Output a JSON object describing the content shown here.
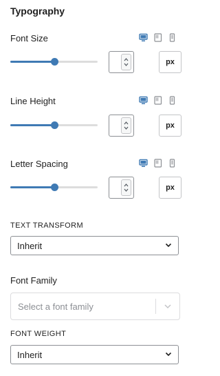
{
  "section_title": "Typography",
  "font_size": {
    "label": "Font Size",
    "value_fraction": 0.5,
    "value": "",
    "unit": "px"
  },
  "line_height": {
    "label": "Line Height",
    "value_fraction": 0.5,
    "value": "",
    "unit": "px"
  },
  "letter_spacing": {
    "label": "Letter Spacing",
    "value_fraction": 0.5,
    "value": "",
    "unit": "px"
  },
  "text_transform": {
    "label": "TEXT TRANSFORM",
    "selected": "Inherit"
  },
  "font_family": {
    "label": "Font Family",
    "placeholder": "Select a font family"
  },
  "font_weight": {
    "label": "FONT WEIGHT",
    "selected": "Inherit"
  },
  "device_icons": [
    "desktop-icon",
    "tablet-icon",
    "mobile-icon"
  ],
  "colors": {
    "accent": "#3f7ab4",
    "track": "#dddddd",
    "border": "#8c8f94"
  }
}
